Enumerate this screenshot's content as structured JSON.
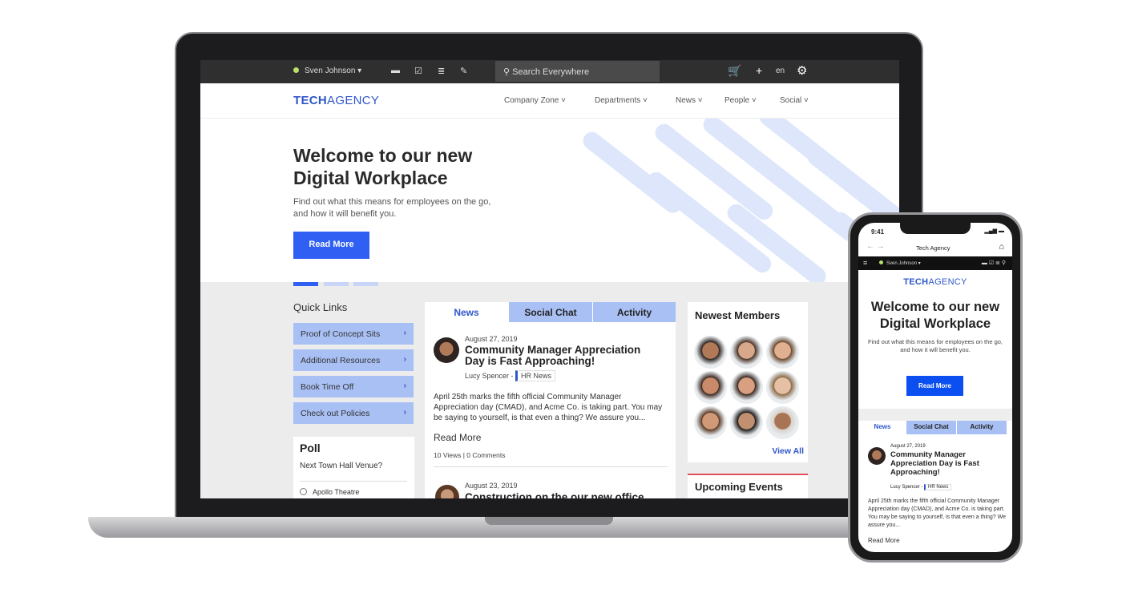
{
  "laptop": {
    "topbar": {
      "user": "Sven Johnson",
      "user_status_color": "#b8e06a",
      "icons": [
        "chat-icon",
        "tasks-icon",
        "news-icon",
        "edit-icon"
      ],
      "search_placeholder": "Search Everywhere",
      "language": "en",
      "right_icons": [
        "cart-icon",
        "plus-icon",
        "gear-icon"
      ]
    },
    "nav": {
      "logo_bold": "TECH",
      "logo_rest": "AGENCY",
      "items": [
        {
          "label": "Company Zone"
        },
        {
          "label": "Departments"
        },
        {
          "label": "News"
        },
        {
          "label": "People"
        },
        {
          "label": "Social"
        }
      ]
    },
    "hero": {
      "title_line1": "Welcome to our new",
      "title_line2": "Digital Workplace",
      "subtitle_line1": "Find out what this means for employees on the go,",
      "subtitle_line2": "and how it will benefit you.",
      "button": "Read More"
    },
    "quick_links": {
      "title": "Quick Links",
      "items": [
        {
          "label": "Proof of Concept Sits"
        },
        {
          "label": "Additional Resources"
        },
        {
          "label": "Book Time Off"
        },
        {
          "label": "Check out Policies"
        }
      ]
    },
    "poll": {
      "title": "Poll",
      "question": "Next Town Hall Venue?",
      "options": [
        {
          "label": "Apollo Theatre"
        }
      ]
    },
    "tabs": [
      {
        "label": "News",
        "active": true
      },
      {
        "label": "Social Chat"
      },
      {
        "label": "Activity"
      }
    ],
    "news": [
      {
        "date": "August 27, 2019",
        "title": "Community Manager Appreciation Day is Fast Approaching!",
        "author": "Lucy Spencer -",
        "category": "HR News",
        "excerpt": "April 25th marks the fifth official Community Manager Appreciation day (CMAD), and Acme Co. is taking part. You may be saying to yourself, is that even a thing? We assure you...",
        "read_more": "Read More",
        "stats": "10 Views | 0 Comments"
      },
      {
        "date": "August 23, 2019",
        "title": "Construction on the our new office"
      }
    ],
    "members": {
      "title": "Newest Members",
      "view_all": "View All",
      "count": 9
    },
    "events": {
      "title": "Upcoming Events"
    }
  },
  "phone": {
    "time": "9:41",
    "browser_title": "Tech Agency",
    "user": "Sven Johnson",
    "logo_bold": "TECH",
    "logo_rest": "AGENCY",
    "hero": {
      "title_line1": "Welcome to our new",
      "title_line2": "Digital Workplace",
      "subtitle": "Find out what this means for employees on the go, and how it will benefit you.",
      "button": "Read More"
    },
    "tabs": [
      {
        "label": "News",
        "active": true
      },
      {
        "label": "Social Chat"
      },
      {
        "label": "Activity"
      }
    ],
    "news": {
      "date": "August 27, 2019",
      "title": "Community Manager Appreciation Day is Fast Approaching!",
      "author": "Lucy Spencer -",
      "category": "HR News",
      "excerpt": "April 25th marks the fifth official Community Manager Appreciation day (CMAD), and Acme Co. is taking part. You may be saying to yourself, is that even a thing? We assure you...",
      "read_more": "Read More"
    }
  },
  "colors": {
    "accent": "#2f5ff3",
    "link_blue": "#2f57c9",
    "tab_light": "#a9c0f5",
    "events_rule": "#e0505a"
  }
}
